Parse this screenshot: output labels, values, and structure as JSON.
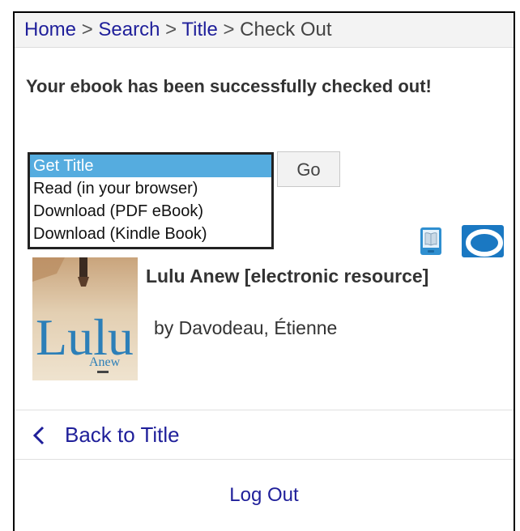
{
  "breadcrumb": {
    "items": [
      "Home",
      "Search",
      "Title",
      "Check Out"
    ],
    "separator": ">"
  },
  "message": "Your ebook has been successfully checked out!",
  "title_select": {
    "options": [
      "Get Title",
      "Read (in your browser)",
      "Download (PDF eBook)",
      "Download (Kindle Book)"
    ],
    "selected": "Get Title"
  },
  "go_button": "Go",
  "format_icons": [
    "ebook-icon",
    "overdrive-icon"
  ],
  "book": {
    "title": "Lulu Anew [electronic resource]",
    "author": "by Davodeau, Étienne",
    "cover_title": "Lulu",
    "cover_subtitle": "Anew"
  },
  "back_link": "Back to Title",
  "logout_link": "Log Out",
  "colors": {
    "link": "#1f1f9a",
    "selected_option": "#55acdf",
    "breadcrumb_bg": "#f3f3f3"
  }
}
